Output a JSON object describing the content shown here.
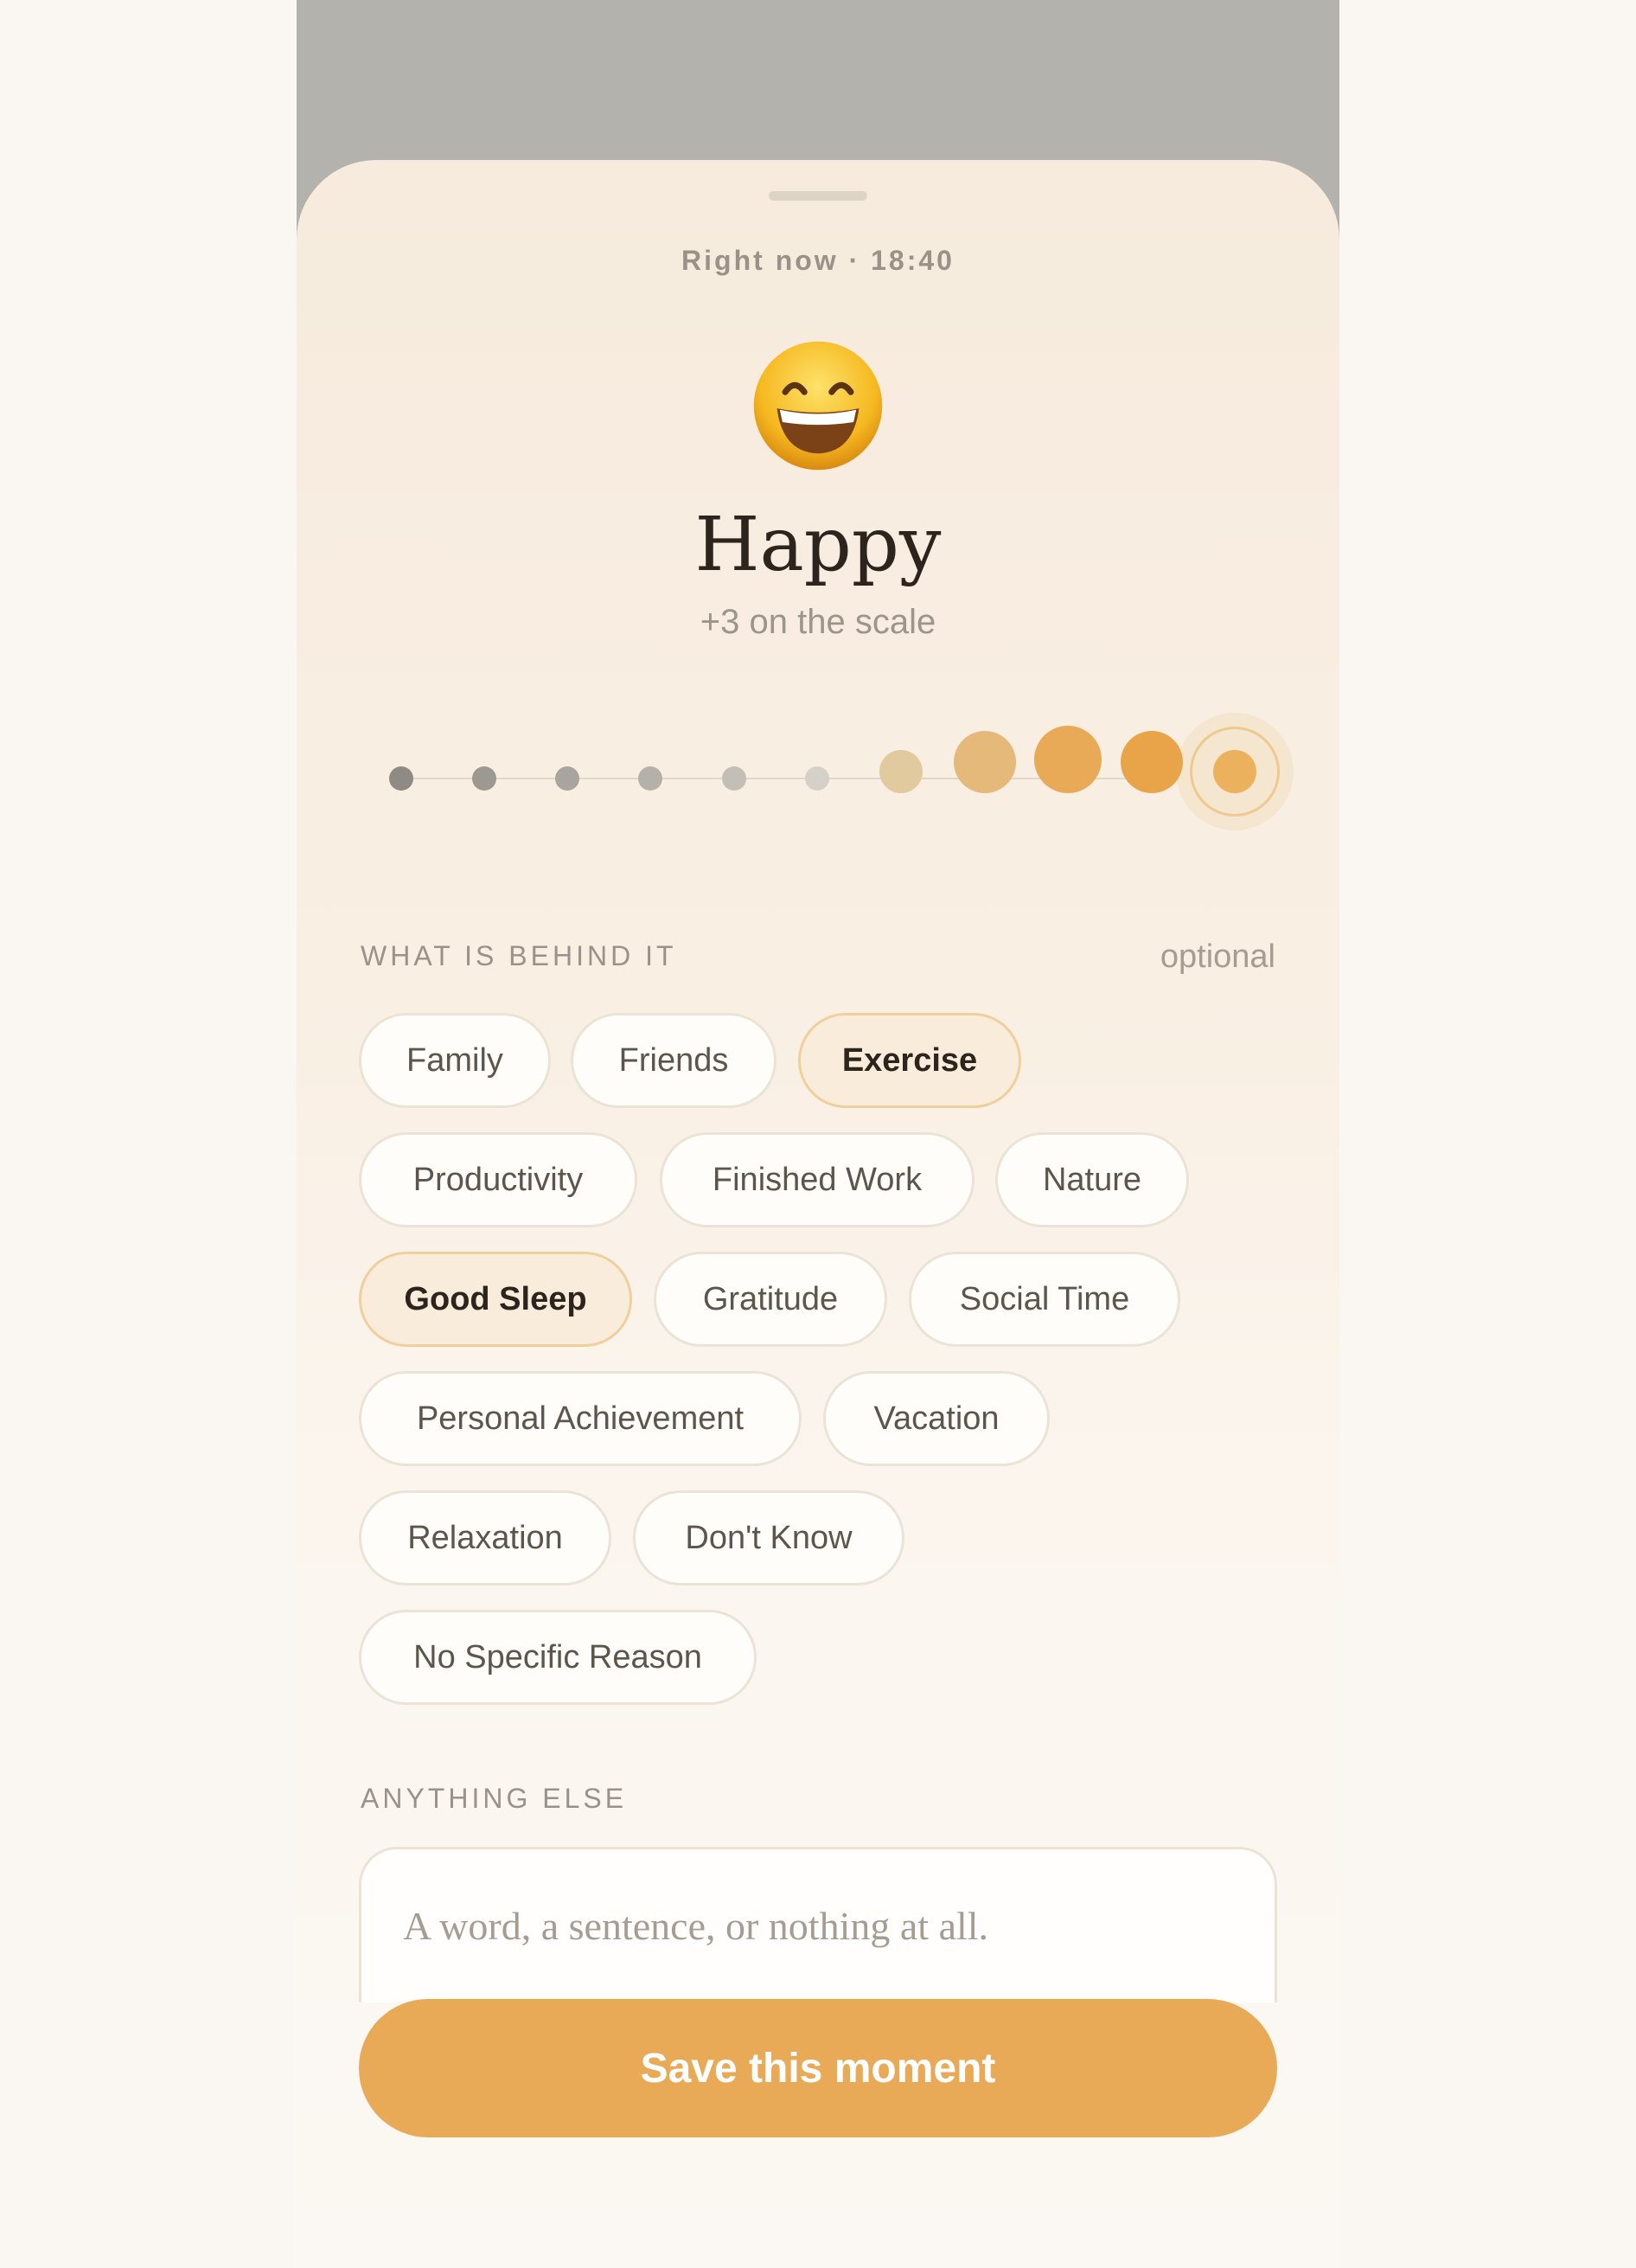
{
  "entry": {
    "timestamp": "Right now · 18:40",
    "mood_title": "Happy",
    "mood_subtitle": "+3 on the scale",
    "mood_emoji": "grinning-face-with-smiling-eyes",
    "scale": {
      "min": -7,
      "max": 3,
      "selected": 3,
      "steps": 11
    }
  },
  "reasons": {
    "label": "WHAT IS BEHIND IT",
    "optional_label": "optional",
    "chips": [
      {
        "label": "Family",
        "selected": false
      },
      {
        "label": "Friends",
        "selected": false
      },
      {
        "label": "Exercise",
        "selected": true
      },
      {
        "label": "Productivity",
        "selected": false
      },
      {
        "label": "Finished Work",
        "selected": false
      },
      {
        "label": "Nature",
        "selected": false
      },
      {
        "label": "Good Sleep",
        "selected": true
      },
      {
        "label": "Gratitude",
        "selected": false
      },
      {
        "label": "Social Time",
        "selected": false
      },
      {
        "label": "Personal Achievement",
        "selected": false
      },
      {
        "label": "Vacation",
        "selected": false
      },
      {
        "label": "Relaxation",
        "selected": false
      },
      {
        "label": "Don't Know",
        "selected": false
      },
      {
        "label": "No Specific Reason",
        "selected": false
      }
    ]
  },
  "note": {
    "label": "ANYTHING ELSE",
    "placeholder": "A word, a sentence, or nothing at all."
  },
  "actions": {
    "save_label": "Save this moment"
  },
  "colors": {
    "accent": "#e8aa57",
    "selected_chip_bg": "#f9ecdb",
    "selected_chip_border": "#efcf9c"
  }
}
